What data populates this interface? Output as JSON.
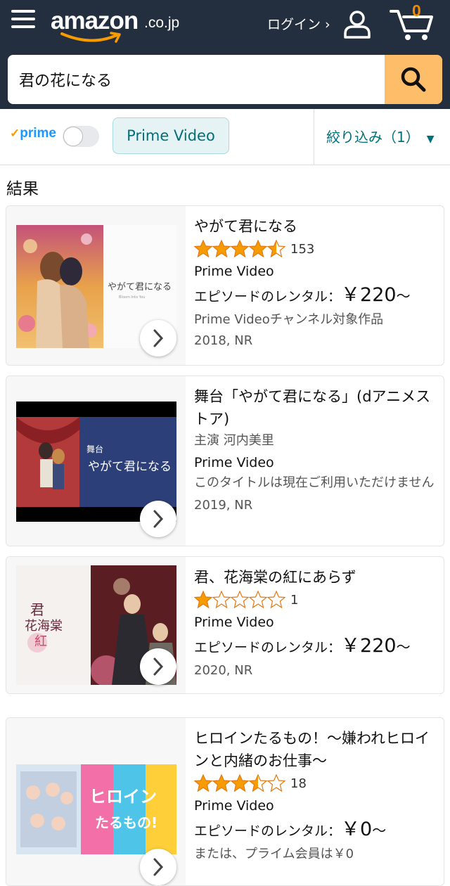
{
  "header": {
    "brand": "amazon",
    "tld": ".co.jp",
    "login_label": "ログイン ›",
    "cart_count": "0"
  },
  "search": {
    "query": "君の花になる"
  },
  "filters": {
    "prime_label": "prime",
    "prime_toggle_on": false,
    "chip_label": "Prime Video",
    "refine_label": "絞り込み（1）"
  },
  "results_label": "結果",
  "results": [
    {
      "title": "やがて君になる",
      "rating": 4.5,
      "review_count": "153",
      "format": "Prime Video",
      "rental_label": "エピソードのレンタル：",
      "price": "￥220",
      "price_suffix": "～",
      "note": "Prime Videoチャンネル対象作品",
      "year_rating": "2018, NR"
    },
    {
      "title": "舞台「やがて君になる」(dアニメストア)",
      "cast": "主演 河内美里",
      "format": "Prime Video",
      "availability": "このタイトルは現在ご利用いただけません",
      "year_rating": "2019, NR"
    },
    {
      "title": "君、花海棠の紅にあらず",
      "rating": 1,
      "review_count": "1",
      "format": "Prime Video",
      "rental_label": "エピソードのレンタル：",
      "price": "￥220",
      "price_suffix": "～",
      "year_rating": "2020, NR"
    },
    {
      "title": "ヒロインたるもの！～嫌われヒロインと内緒のお仕事～",
      "rating": 3.5,
      "review_count": "18",
      "format": "Prime Video",
      "rental_label": "エピソードのレンタル：",
      "price": "￥0",
      "price_suffix": "～",
      "note": "または、プライム会員は￥0"
    }
  ],
  "colors": {
    "header_bg": "#232f3e",
    "search_button": "#febd69",
    "star": "#f79c00",
    "chip_text": "#00707a"
  }
}
